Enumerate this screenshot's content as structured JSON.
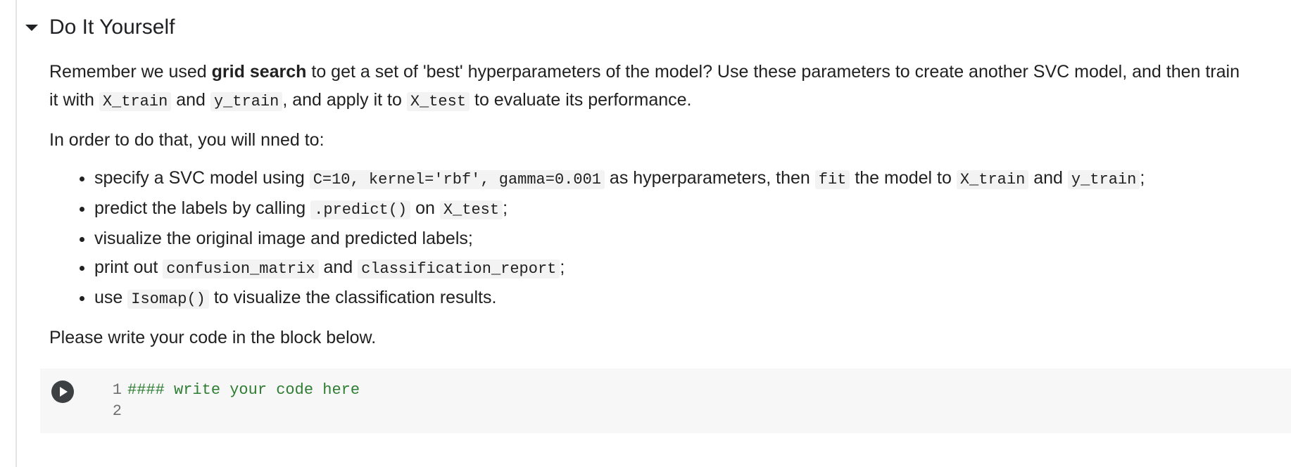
{
  "section": {
    "title": "Do It Yourself"
  },
  "markdown": {
    "p1": {
      "t1": "Remember we used ",
      "bold": "grid search",
      "t2": " to get a set of 'best' hyperparameters of the model? Use these parameters to create another SVC model, and then train it with ",
      "c1": "X_train",
      "t3": " and ",
      "c2": "y_train",
      "t4": ", and apply it to ",
      "c3": "X_test",
      "t5": " to evaluate its performance."
    },
    "p2": "In order to do that, you will nned to:",
    "items": [
      {
        "t1": "specify a SVC model using ",
        "c1": "C=10, kernel='rbf', gamma=0.001",
        "t2": " as hyperparameters, then ",
        "c2": "fit",
        "t3": " the model to ",
        "c3": "X_train",
        "t4": " and ",
        "c4": "y_train",
        "t5": ";"
      },
      {
        "t1": "predict the labels by calling ",
        "c1": ".predict()",
        "t2": " on ",
        "c2": "X_test",
        "t3": ";"
      },
      {
        "t1": "visualize the original image and predicted labels;"
      },
      {
        "t1": "print out ",
        "c1": "confusion_matrix",
        "t2": " and ",
        "c2": "classification_report",
        "t3": ";"
      },
      {
        "t1": "use ",
        "c1": "Isomap()",
        "t2": " to visualize the classification results."
      }
    ],
    "p3": "Please write your code in the block below."
  },
  "code_cell": {
    "lines": [
      {
        "num": "1",
        "text": "#### write your code here"
      },
      {
        "num": "2",
        "text": ""
      }
    ]
  },
  "icons": {
    "collapse": "caret-down-icon",
    "run": "play-icon"
  },
  "colors": {
    "comment": "#2e7d32",
    "code_bg": "#f7f7f7",
    "run_button": "#3c4043"
  }
}
